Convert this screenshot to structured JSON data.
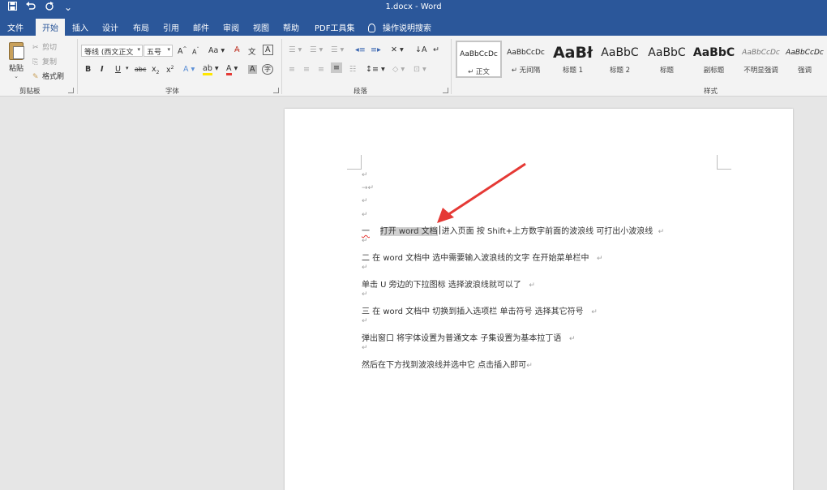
{
  "window": {
    "title": "1.docx  -  Word"
  },
  "qat": {
    "save_icon": "save-icon",
    "undo_icon": "undo-icon",
    "redo_icon": "redo-icon",
    "more": "⌄"
  },
  "tabs": [
    "文件",
    "开始",
    "插入",
    "设计",
    "布局",
    "引用",
    "邮件",
    "审阅",
    "视图",
    "帮助",
    "PDF工具集"
  ],
  "active_tab": "开始",
  "tell_me": "操作说明搜索",
  "clipboard": {
    "paste": "粘贴",
    "cut": "剪切",
    "copy": "复制",
    "format_painter": "格式刷",
    "group": "剪贴板"
  },
  "font": {
    "name": "等线 (西文正文",
    "size": "五号",
    "group": "字体"
  },
  "paragraph": {
    "group": "段落"
  },
  "styles": {
    "group": "样式",
    "items": [
      {
        "sample": "AaBbCcDc",
        "name": "↵ 正文"
      },
      {
        "sample": "AaBbCcDc",
        "name": "↵ 无间隔"
      },
      {
        "sample": "AaBł",
        "name": "标题 1"
      },
      {
        "sample": "AaBbC",
        "name": "标题 2"
      },
      {
        "sample": "AaBbC",
        "name": "标题"
      },
      {
        "sample": "AaBbC",
        "name": "副标题"
      },
      {
        "sample": "AaBbCcDc",
        "name": "不明显强调"
      },
      {
        "sample": "AaBbCcDc",
        "name": "强调"
      }
    ]
  },
  "document": {
    "pilcrow": "↵",
    "line1_mark": "一",
    "line1_selected": "打开 word 文档",
    "line1_rest": "进入页面   按 Shift+上方数字前面的波浪线   可打出小波浪线",
    "line2": "二   在 word 文档中   选中需要输入波浪线的文字   在开始菜单栏中",
    "line3": "单击 U 旁边的下拉图标   选择波浪线就可以了",
    "line4": "三   在 word 文档中   切换到插入选项栏   单击符号   选择其它符号",
    "line5": "弹出窗口   将字体设置为普通文本   子集设置为基本拉丁语",
    "line6": "然后在下方找到波浪线并选中它   点击插入即可"
  },
  "colors": {
    "accent": "#2b579a",
    "annotation_arrow": "#e53935"
  }
}
